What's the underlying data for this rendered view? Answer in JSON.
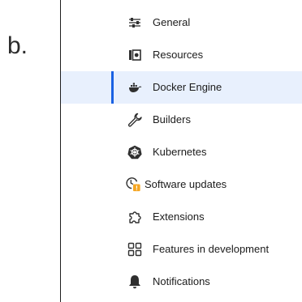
{
  "figure_label": "b.",
  "colors": {
    "active_bg": "#e8f0fd",
    "active_bar": "#1a61e3",
    "arrow": "#d8201f",
    "icon": "#2f2f2f"
  },
  "menu": {
    "items": [
      {
        "label": "General",
        "icon": "sliders-icon"
      },
      {
        "label": "Resources",
        "icon": "resources-icon"
      },
      {
        "label": "Docker Engine",
        "icon": "docker-whale-icon",
        "active": true
      },
      {
        "label": "Builders",
        "icon": "wrench-icon"
      },
      {
        "label": "Kubernetes",
        "icon": "kubernetes-icon"
      },
      {
        "label": "Software updates",
        "icon": "clock-update-icon"
      },
      {
        "label": "Extensions",
        "icon": "puzzle-icon"
      },
      {
        "label": "Features in development",
        "icon": "grid-icon"
      },
      {
        "label": "Notifications",
        "icon": "bell-icon"
      }
    ]
  }
}
